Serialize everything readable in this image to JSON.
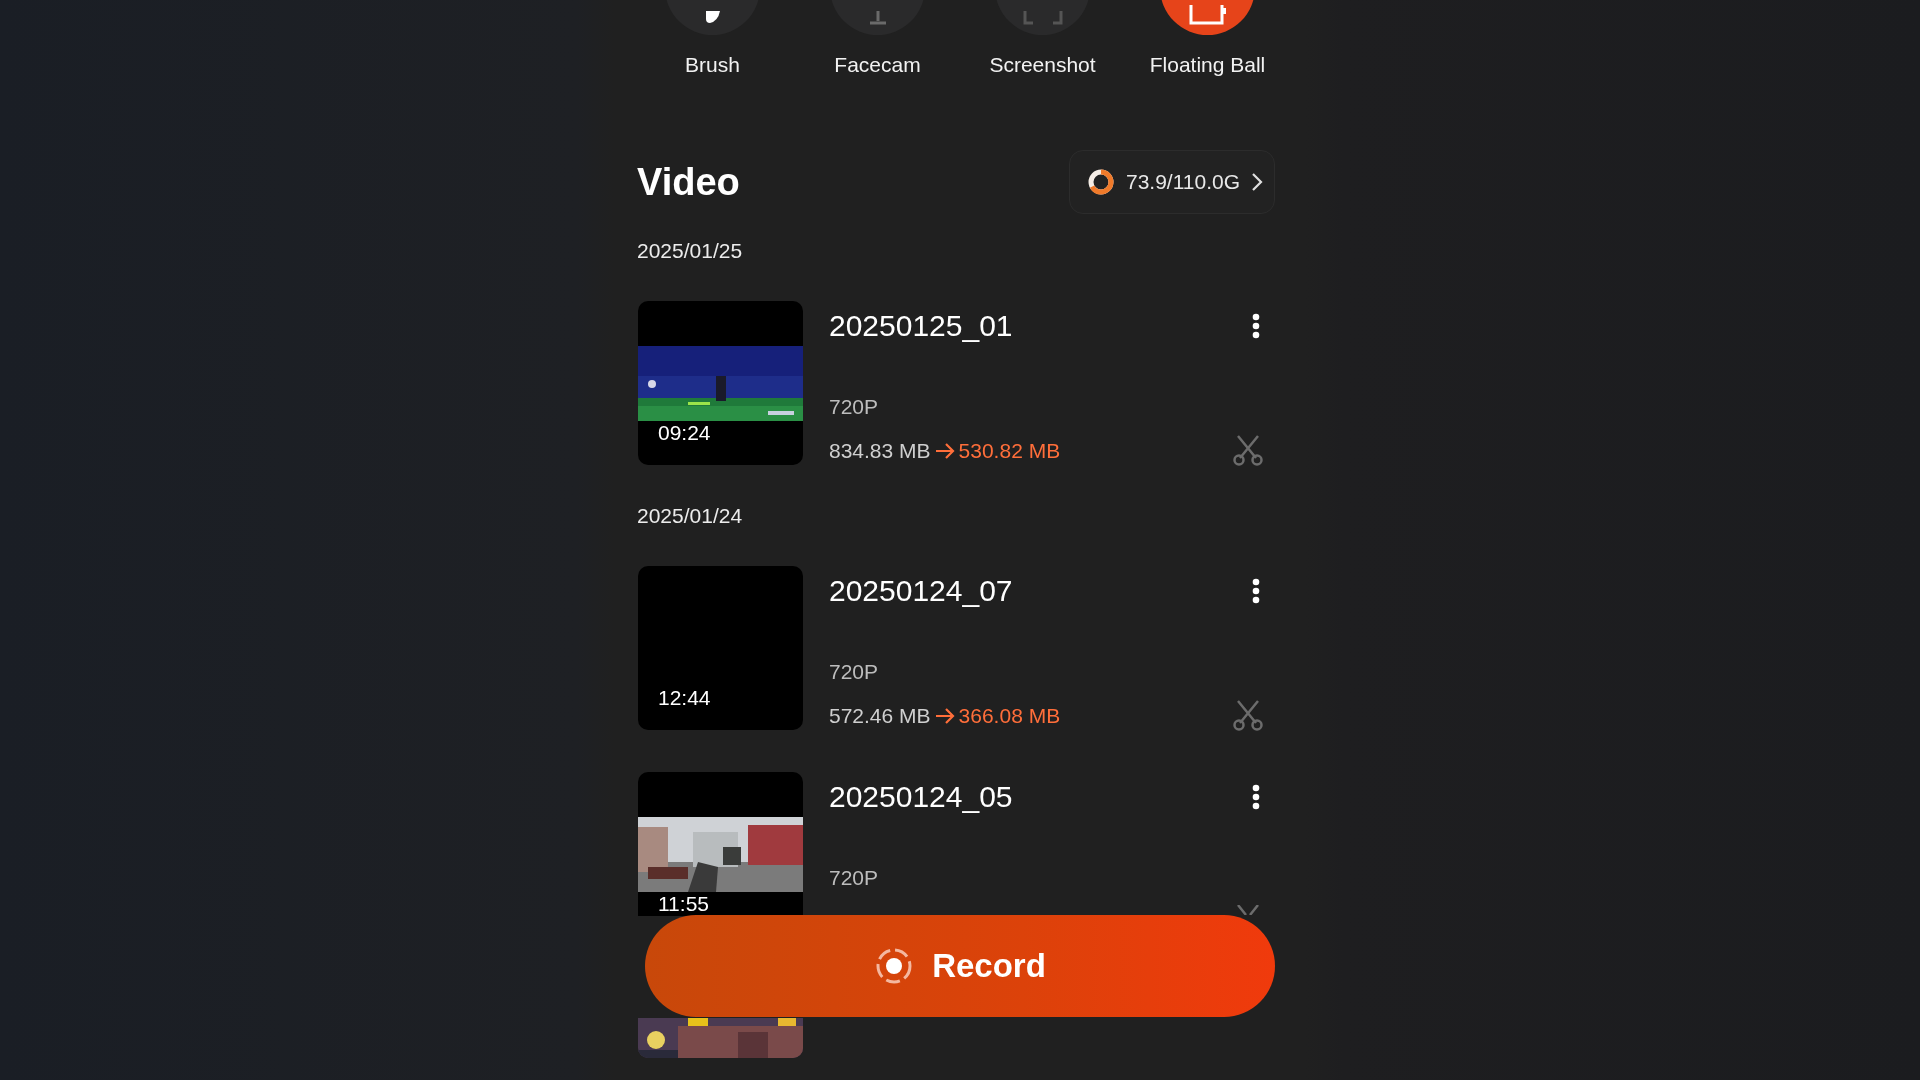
{
  "tools": [
    {
      "label": "Brush",
      "active": false
    },
    {
      "label": "Facecam",
      "active": false
    },
    {
      "label": "Screenshot",
      "active": false
    },
    {
      "label": "Floating Ball",
      "active": true
    }
  ],
  "video": {
    "title": "Video",
    "storage": {
      "text": "73.9/110.0G",
      "level": 0.67
    }
  },
  "groups": [
    {
      "date": "2025/01/25",
      "items": [
        {
          "title": "20250125_01",
          "thumbnail": {
            "kind": "picture"
          },
          "duration": "09:24",
          "resolution": "720P",
          "size": "834.83 MB",
          "compressed": "530.82 MB"
        }
      ]
    },
    {
      "date": "2025/01/24",
      "items": [
        {
          "title": "20250124_07",
          "thumbnail": {
            "kind": "blank"
          },
          "duration": "12:44",
          "resolution": "720P",
          "size": "572.46 MB",
          "compressed": "366.08 MB"
        },
        {
          "title": "20250124_05",
          "thumbnail": {
            "kind": "picture"
          },
          "duration": "11:55",
          "resolution": "720P"
        },
        {
          "thumbnail": {
            "kind": "picture"
          }
        }
      ]
    }
  ],
  "record_button": {
    "label": "Record"
  }
}
